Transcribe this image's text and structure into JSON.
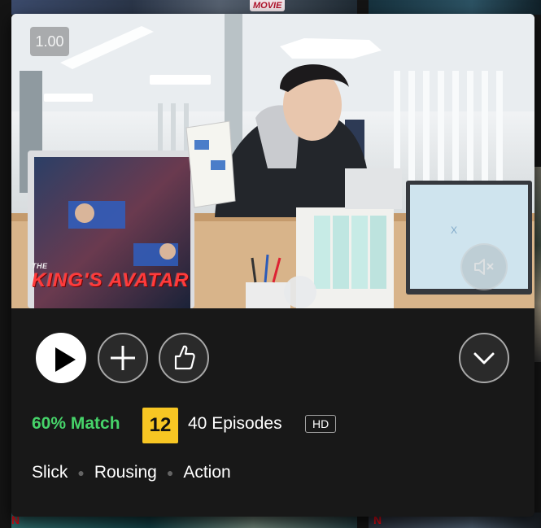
{
  "background": {
    "top_badge": "MOVIE",
    "logo_letter": "N"
  },
  "preview": {
    "playback_speed": "1.00",
    "title_small": "THE",
    "title_main": "KING'S AVATAR",
    "mute_icon": "speaker-muted-icon"
  },
  "controls": {
    "play_icon": "play-icon",
    "add_icon": "plus-icon",
    "rate_icon": "thumbs-up-icon",
    "more_icon": "chevron-down-icon"
  },
  "meta": {
    "match": "60% Match",
    "maturity_rating": "12",
    "episodes": "40 Episodes",
    "quality": "HD"
  },
  "genres": [
    "Slick",
    "Rousing",
    "Action"
  ],
  "colors": {
    "match_green": "#46d369",
    "maturity_yellow": "#f7c623",
    "card_bg": "#181818",
    "brand_red": "#e50914"
  }
}
